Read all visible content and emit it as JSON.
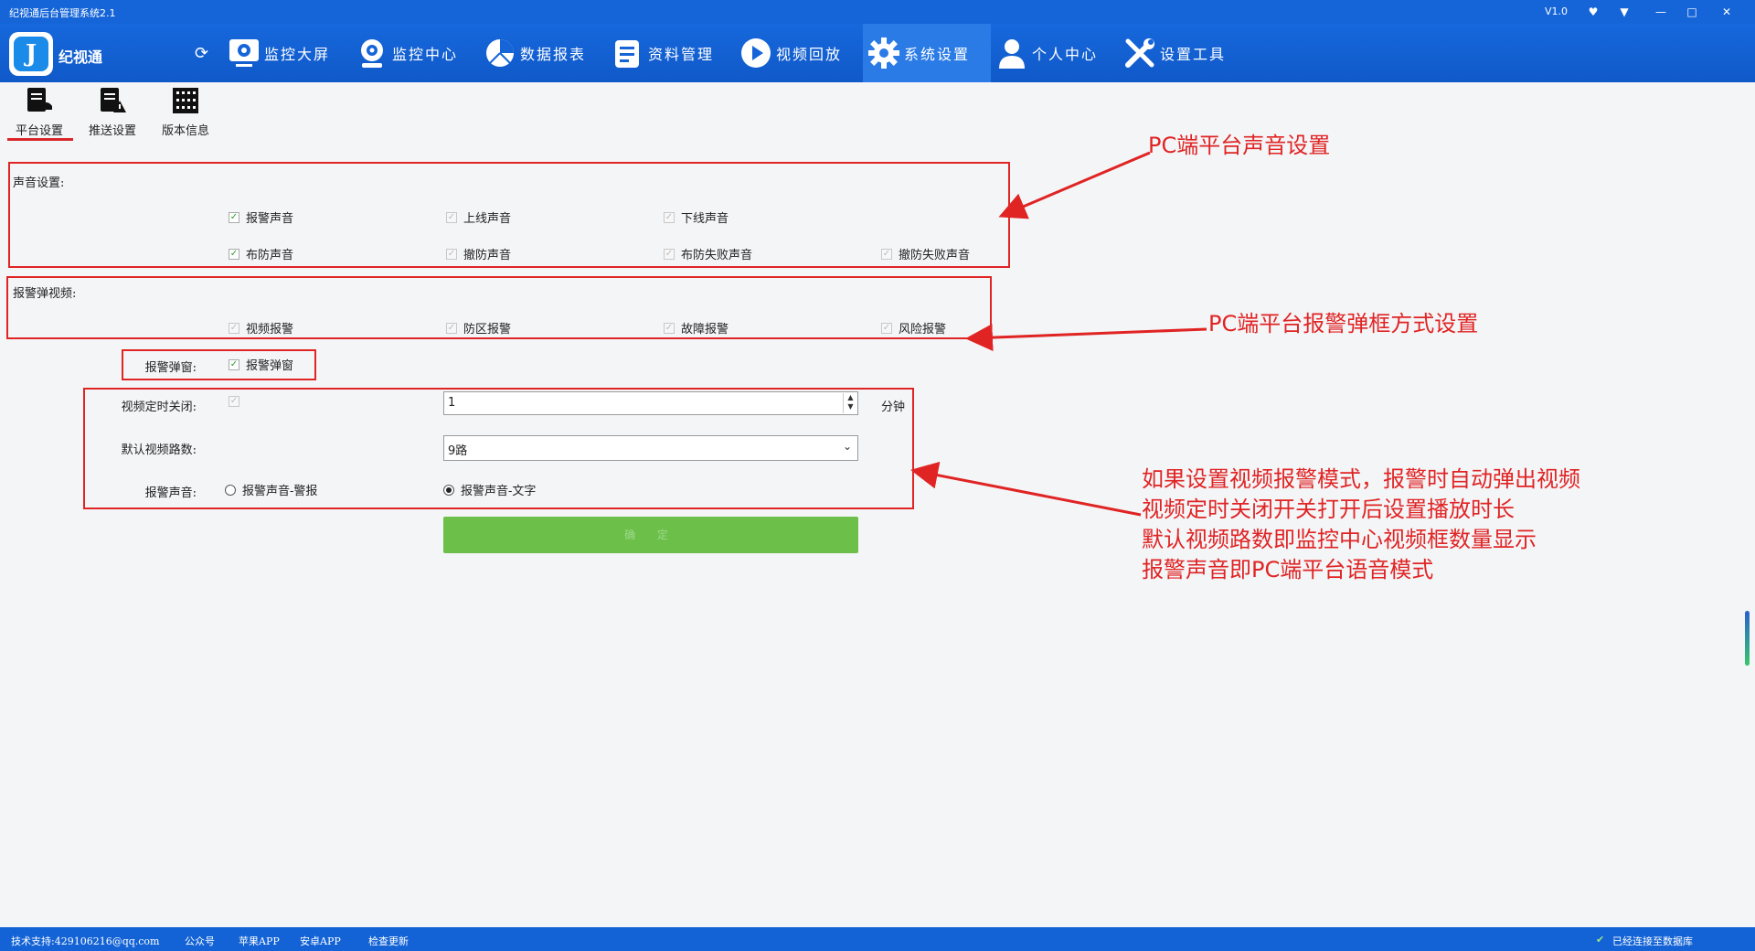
{
  "window": {
    "title": "纪视通后台管理系统2.1",
    "version": "V1.0"
  },
  "header": {
    "brand": "纪视通",
    "nav": [
      {
        "label": "监控大屏",
        "icon": "monitor-icon"
      },
      {
        "label": "监控中心",
        "icon": "camera-icon"
      },
      {
        "label": "数据报表",
        "icon": "pie-chart-icon"
      },
      {
        "label": "资料管理",
        "icon": "document-icon"
      },
      {
        "label": "视频回放",
        "icon": "play-icon"
      },
      {
        "label": "系统设置",
        "icon": "gear-icon",
        "active": true
      },
      {
        "label": "个人中心",
        "icon": "user-icon"
      },
      {
        "label": "设置工具",
        "icon": "tools-icon"
      }
    ]
  },
  "subtabs": [
    {
      "label": "平台设置",
      "active": true
    },
    {
      "label": "推送设置"
    },
    {
      "label": "版本信息"
    }
  ],
  "sound": {
    "title": "声音设置:",
    "options": [
      {
        "label": "报警声音",
        "checked": true
      },
      {
        "label": "上线声音",
        "checked": false
      },
      {
        "label": "下线声音",
        "checked": false
      },
      {
        "label": "布防声音",
        "checked": true
      },
      {
        "label": "撤防声音",
        "checked": false
      },
      {
        "label": "布防失败声音",
        "checked": false
      },
      {
        "label": "撤防失败声音",
        "checked": false
      }
    ]
  },
  "popup_video": {
    "title": "报警弹视频:",
    "options": [
      {
        "label": "视频报警",
        "checked": false
      },
      {
        "label": "防区报警",
        "checked": false
      },
      {
        "label": "故障报警",
        "checked": false
      },
      {
        "label": "风险报警",
        "checked": false
      }
    ]
  },
  "popup_window": {
    "label": "报警弹窗:",
    "option": "报警弹窗",
    "checked": true
  },
  "video_timer": {
    "label": "视频定时关闭:",
    "value": "1",
    "unit": "分钟"
  },
  "default_channels": {
    "label": "默认视频路数:",
    "value": "9路"
  },
  "alarm_voice": {
    "label": "报警声音:",
    "options": [
      "报警声音-警报",
      "报警声音-文字"
    ],
    "selected": 1
  },
  "confirm_label": "确 定",
  "annotations": {
    "sound": "PC端平台声音设置",
    "popup": "PC端平台报警弹框方式设置",
    "video_lines": [
      "如果设置视频报警模式，报警时自动弹出视频",
      "视频定时关闭开关打开后设置播放时长",
      "默认视频路数即监控中心视频框数量显示",
      "报警声音即PC端平台语音模式"
    ]
  },
  "footer": {
    "support": "技术支持:429106216@qq.com",
    "public": "公众号",
    "apple": "苹果APP",
    "android": "安卓APP",
    "update": "检查更新",
    "status": "已经连接至数据库"
  },
  "colors": {
    "header": "#1565d8",
    "annotation": "#e02424",
    "confirm": "#6cc04a"
  }
}
